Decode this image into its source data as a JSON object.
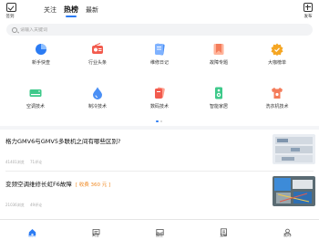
{
  "header": {
    "checkin_label": "签到",
    "tabs": [
      {
        "label": "关注",
        "active": false
      },
      {
        "label": "热榜",
        "active": true
      },
      {
        "label": "最新",
        "active": false
      }
    ],
    "publish_label": "发布"
  },
  "search": {
    "placeholder": "请输入关键词"
  },
  "categories": [
    {
      "label": "新手快查",
      "icon": "pie-chart-icon",
      "color": "#2b7bf3"
    },
    {
      "label": "行业头条",
      "icon": "radio-icon",
      "color": "#f25b4e"
    },
    {
      "label": "维修日记",
      "icon": "notebook-icon",
      "color": "#4a8ff5"
    },
    {
      "label": "故障专题",
      "icon": "bookmark-icon",
      "color": "#f47c5a"
    },
    {
      "label": "大咖榜单",
      "icon": "badge-icon",
      "color": "#f5a623"
    },
    {
      "label": "空调技术",
      "icon": "air-conditioner-icon",
      "color": "#3ec98a"
    },
    {
      "label": "制冷技术",
      "icon": "water-drop-icon",
      "color": "#4a8ff5"
    },
    {
      "label": "数码技术",
      "icon": "cards-icon",
      "color": "#f25b4e"
    },
    {
      "label": "智能家居",
      "icon": "speaker-icon",
      "color": "#3ec98a"
    },
    {
      "label": "洗衣机技术",
      "icon": "washing-machine-icon",
      "color": "#f47c5a"
    }
  ],
  "articles": [
    {
      "title": "格力GMV6与GMV5多联机之间有哪些区别?",
      "reward": "",
      "views": "41401浏览",
      "comments": "71评论"
    },
    {
      "title": "变频空调维修长虹F6故障",
      "reward": "[ 收费 360 元 ]",
      "views": "21036浏览",
      "comments": "49评论"
    }
  ],
  "bottom_nav": [
    {
      "label": "首页",
      "icon": "home-icon",
      "active": true
    },
    {
      "label": "问答",
      "icon": "chat-icon",
      "active": false
    },
    {
      "label": "圈主",
      "icon": "mail-icon",
      "active": false
    },
    {
      "label": "工单",
      "icon": "document-icon",
      "active": false
    },
    {
      "label": "我的",
      "icon": "user-icon",
      "active": false
    }
  ],
  "colors": {
    "accent": "#2b7bf3",
    "reward": "#f08a24"
  }
}
